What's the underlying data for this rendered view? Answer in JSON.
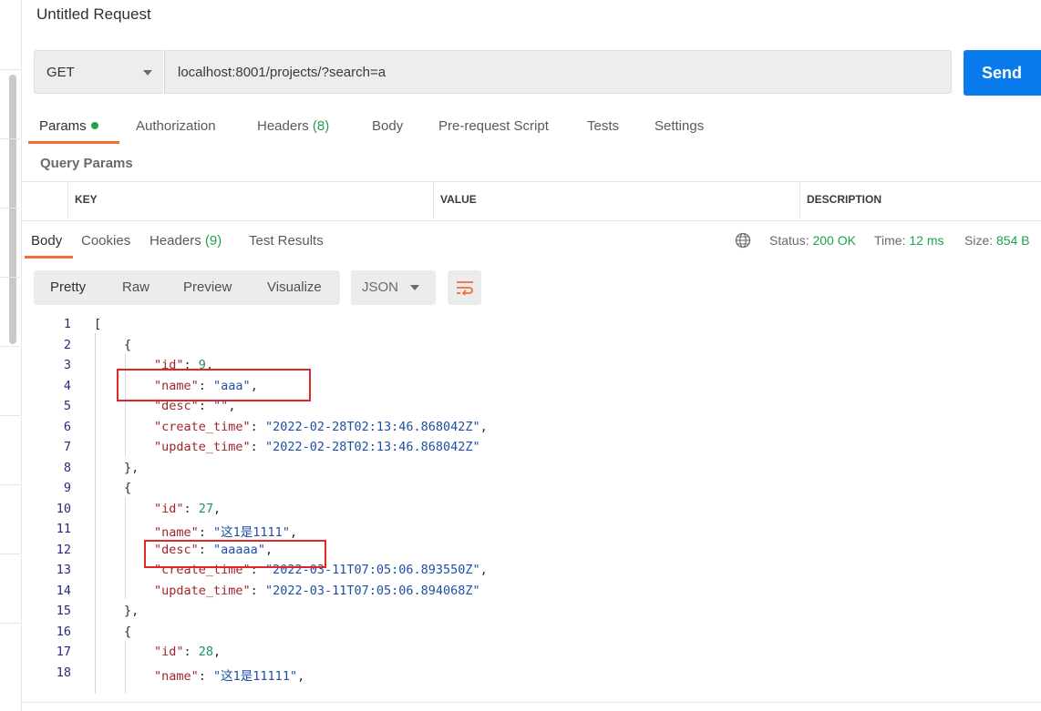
{
  "request": {
    "title": "Untitled Request",
    "method": "GET",
    "url": "localhost:8001/projects/?search=a",
    "send_label": "Send"
  },
  "request_tabs": [
    {
      "label": "Params",
      "active": true,
      "dot": true
    },
    {
      "label": "Authorization"
    },
    {
      "label": "Headers",
      "count": "(8)"
    },
    {
      "label": "Body"
    },
    {
      "label": "Pre-request Script"
    },
    {
      "label": "Tests"
    },
    {
      "label": "Settings"
    }
  ],
  "query_params": {
    "label": "Query Params",
    "columns": [
      "KEY",
      "VALUE",
      "DESCRIPTION"
    ]
  },
  "response_tabs": [
    {
      "label": "Body",
      "active": true
    },
    {
      "label": "Cookies"
    },
    {
      "label": "Headers",
      "count": "(9)"
    },
    {
      "label": "Test Results"
    }
  ],
  "status": {
    "status_label": "Status:",
    "status_value": "200 OK",
    "time_label": "Time:",
    "time_value": "12 ms",
    "size_label": "Size:",
    "size_value": "854 B"
  },
  "view_modes": [
    "Pretty",
    "Raw",
    "Preview",
    "Visualize"
  ],
  "format": "JSON",
  "code_lines": [
    {
      "n": "1",
      "indent": 0,
      "parts": [
        [
          "p",
          "["
        ]
      ]
    },
    {
      "n": "2",
      "indent": 1,
      "parts": [
        [
          "p",
          "{"
        ]
      ]
    },
    {
      "n": "3",
      "indent": 2,
      "parts": [
        [
          "key",
          "\"id\""
        ],
        [
          "p",
          ": "
        ],
        [
          "num",
          "9"
        ],
        [
          "p",
          ","
        ]
      ]
    },
    {
      "n": "4",
      "indent": 2,
      "parts": [
        [
          "key",
          "\"name\""
        ],
        [
          "p",
          ": "
        ],
        [
          "str",
          "\"aaa\""
        ],
        [
          "p",
          ","
        ]
      ]
    },
    {
      "n": "5",
      "indent": 2,
      "parts": [
        [
          "key",
          "\"desc\""
        ],
        [
          "p",
          ": "
        ],
        [
          "str",
          "\"\""
        ],
        [
          "p",
          ","
        ]
      ]
    },
    {
      "n": "6",
      "indent": 2,
      "parts": [
        [
          "key",
          "\"create_time\""
        ],
        [
          "p",
          ": "
        ],
        [
          "str",
          "\"2022-02-28T02:13:46.868042Z\""
        ],
        [
          "p",
          ","
        ]
      ]
    },
    {
      "n": "7",
      "indent": 2,
      "parts": [
        [
          "key",
          "\"update_time\""
        ],
        [
          "p",
          ": "
        ],
        [
          "str",
          "\"2022-02-28T02:13:46.868042Z\""
        ]
      ]
    },
    {
      "n": "8",
      "indent": 1,
      "parts": [
        [
          "p",
          "},"
        ]
      ]
    },
    {
      "n": "9",
      "indent": 1,
      "parts": [
        [
          "p",
          "{"
        ]
      ]
    },
    {
      "n": "10",
      "indent": 2,
      "parts": [
        [
          "key",
          "\"id\""
        ],
        [
          "p",
          ": "
        ],
        [
          "num",
          "27"
        ],
        [
          "p",
          ","
        ]
      ]
    },
    {
      "n": "11",
      "indent": 2,
      "parts": [
        [
          "key",
          "\"name\""
        ],
        [
          "p",
          ": "
        ],
        [
          "str",
          "\"这1是1111\""
        ],
        [
          "p",
          ","
        ]
      ]
    },
    {
      "n": "12",
      "indent": 2,
      "parts": [
        [
          "key",
          "\"desc\""
        ],
        [
          "p",
          ": "
        ],
        [
          "str",
          "\"aaaaa\""
        ],
        [
          "p",
          ","
        ]
      ]
    },
    {
      "n": "13",
      "indent": 2,
      "parts": [
        [
          "key",
          "\"create_time\""
        ],
        [
          "p",
          ": "
        ],
        [
          "str",
          "\"2022-03-11T07:05:06.893550Z\""
        ],
        [
          "p",
          ","
        ]
      ]
    },
    {
      "n": "14",
      "indent": 2,
      "parts": [
        [
          "key",
          "\"update_time\""
        ],
        [
          "p",
          ": "
        ],
        [
          "str",
          "\"2022-03-11T07:05:06.894068Z\""
        ]
      ]
    },
    {
      "n": "15",
      "indent": 1,
      "parts": [
        [
          "p",
          "},"
        ]
      ]
    },
    {
      "n": "16",
      "indent": 1,
      "parts": [
        [
          "p",
          "{"
        ]
      ]
    },
    {
      "n": "17",
      "indent": 2,
      "parts": [
        [
          "key",
          "\"id\""
        ],
        [
          "p",
          ": "
        ],
        [
          "num",
          "28"
        ],
        [
          "p",
          ","
        ]
      ]
    },
    {
      "n": "18",
      "indent": 2,
      "parts": [
        [
          "key",
          "\"name\""
        ],
        [
          "p",
          ": "
        ],
        [
          "str",
          "\"这1是11111\""
        ],
        [
          "p",
          ","
        ]
      ]
    }
  ],
  "colors": {
    "accent_orange": "#f26b3a",
    "send_blue": "#097bed",
    "status_green": "#1fa14f",
    "highlight_red": "#e02626"
  },
  "icons": {
    "globe": "globe-icon",
    "wrap": "wrap-lines-icon",
    "method_caret": "chevron-down-icon",
    "format_caret": "chevron-down-icon"
  }
}
